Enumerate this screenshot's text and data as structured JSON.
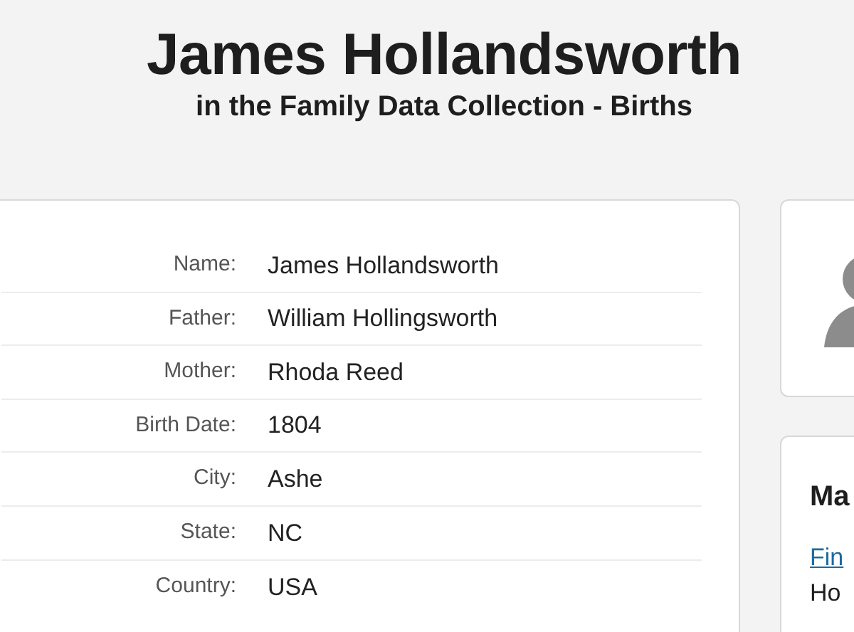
{
  "header": {
    "title": "James Hollandsworth",
    "subtitle": "in the Family Data Collection - Births"
  },
  "record": {
    "fields": [
      {
        "label": "Name:",
        "value": "James Hollandsworth"
      },
      {
        "label": "Father:",
        "value": "William Hollingsworth"
      },
      {
        "label": "Mother:",
        "value": "Rhoda Reed"
      },
      {
        "label": "Birth Date:",
        "value": "1804"
      },
      {
        "label": "City:",
        "value": "Ashe"
      },
      {
        "label": "State:",
        "value": "NC"
      },
      {
        "label": "Country:",
        "value": "USA"
      }
    ]
  },
  "side_card": {
    "heading": "Ma",
    "link": "Fin",
    "text": "Ho"
  }
}
